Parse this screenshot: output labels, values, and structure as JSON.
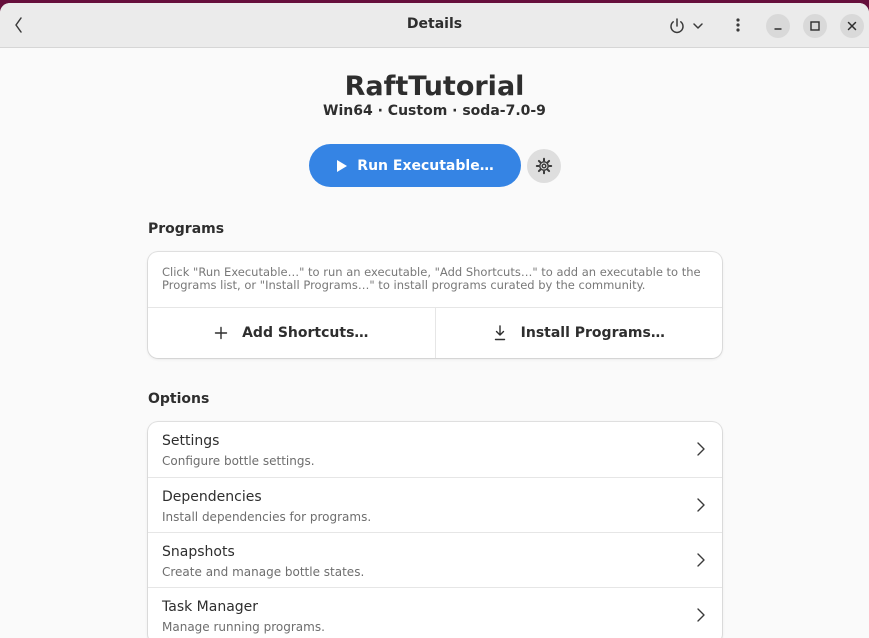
{
  "header": {
    "title": "Details",
    "back_icon": "chevron-left-icon",
    "power_icon": "power-icon",
    "menu_icon": "vertical-dots-icon"
  },
  "hero": {
    "name": "RaftTutorial",
    "subtitle": "Win64 · Custom · soda-7.0-9",
    "run_label": "Run Executable…",
    "run_icon": "play-icon",
    "gear_icon": "gear-icon"
  },
  "programs": {
    "title": "Programs",
    "hint": "Click \"Run Executable…\" to run an executable, \"Add Shortcuts…\" to add an executable to the Programs list, or \"Install Programs…\" to install programs curated by the community.",
    "add_label": "Add Shortcuts…",
    "install_label": "Install Programs…"
  },
  "options": {
    "title": "Options",
    "items": [
      {
        "title": "Settings",
        "subtitle": "Configure bottle settings."
      },
      {
        "title": "Dependencies",
        "subtitle": "Install dependencies for programs."
      },
      {
        "title": "Snapshots",
        "subtitle": "Create and manage bottle states."
      },
      {
        "title": "Task Manager",
        "subtitle": "Manage running programs."
      }
    ]
  },
  "colors": {
    "accent": "#3584e4",
    "headerbar": "#ebebeb",
    "background": "#fafafa",
    "desktop": "#660f3c"
  }
}
